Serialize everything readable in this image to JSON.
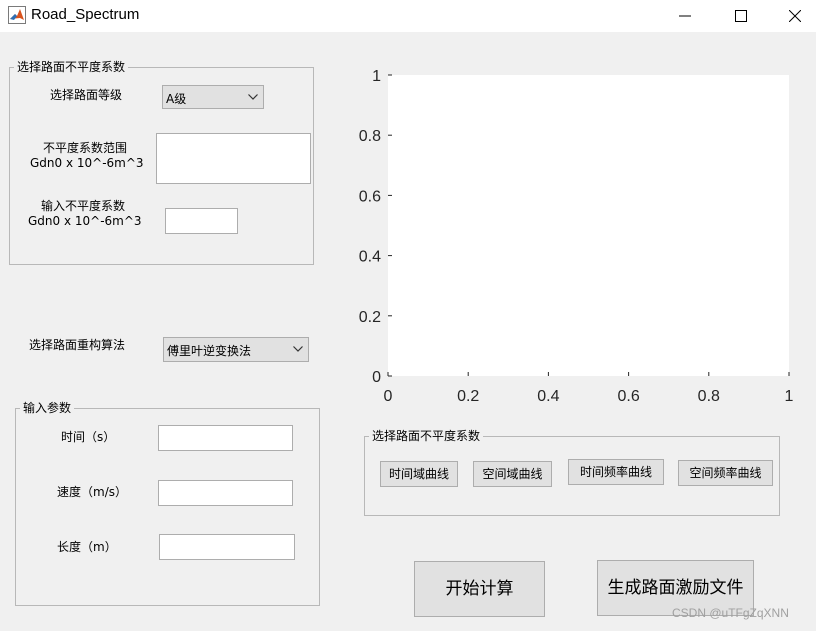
{
  "window": {
    "title": "Road_Spectrum",
    "icon": "matlab-icon"
  },
  "panel_coeff": {
    "title": "选择路面不平度系数",
    "grade_label": "选择路面等级",
    "grade_selected": "A级",
    "range_label_line1": "不平度系数范围",
    "range_label_line2": "Gdn0 x 10^-6m^3",
    "range_value": "",
    "input_label_line1": "输入不平度系数",
    "input_label_line2": "Gdn0 x 10^-6m^3",
    "input_value": ""
  },
  "algorithm": {
    "label": "选择路面重构算法",
    "selected": "傅里叶逆变换法"
  },
  "panel_params": {
    "title": "输入参数",
    "time_label": "时间（s）",
    "time_value": "",
    "speed_label": "速度（m/s）",
    "speed_value": "",
    "length_label": "长度（m）",
    "length_value": ""
  },
  "panel_curves": {
    "title": "选择路面不平度系数",
    "btn_time_domain": "时间域曲线",
    "btn_space_domain": "空间域曲线",
    "btn_time_freq": "时间频率曲线",
    "btn_space_freq": "空间频率曲线"
  },
  "actions": {
    "start_label": "开始计算",
    "generate_label": "生成路面激励文件"
  },
  "chart_data": {
    "type": "line",
    "series": [],
    "xlim": [
      0,
      1
    ],
    "ylim": [
      0,
      1
    ],
    "xticks": [
      "0",
      "0.2",
      "0.4",
      "0.6",
      "0.8",
      "1"
    ],
    "yticks": [
      "0",
      "0.2",
      "0.4",
      "0.6",
      "0.8",
      "1"
    ],
    "grid": false
  },
  "watermark": "CSDN @uTFgZqXNN",
  "colors": {
    "window_bg": "#f0f0f0",
    "axes_bg": "#ffffff",
    "button_bg": "#e1e1e1",
    "border": "#adadad"
  }
}
